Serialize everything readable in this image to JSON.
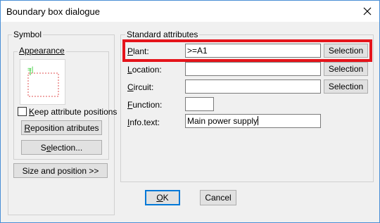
{
  "window": {
    "title": "Boundary box dialogue",
    "close_icon": "close-icon"
  },
  "symbol": {
    "group_label": "Symbol",
    "appearance_label": "Appearance",
    "keep_positions": {
      "label_first": "K",
      "label_rest": "eep attribute positions",
      "checked": false
    },
    "reposition_button": {
      "first": "R",
      "rest": "eposition atributes"
    },
    "selection_button": {
      "before": "S",
      "underlined": "e",
      "after": "lection..."
    },
    "size_position_button": "Size and position >>"
  },
  "standard": {
    "group_label": "Standard attributes",
    "fields": [
      {
        "first": "P",
        "rest": "lant:",
        "value": ">=A1",
        "has_selection": true
      },
      {
        "first": "L",
        "rest": "ocation:",
        "value": "",
        "has_selection": true
      },
      {
        "first": "C",
        "rest": "ircuit:",
        "value": "",
        "has_selection": true
      },
      {
        "first": "F",
        "rest": "unction:",
        "value": "",
        "has_selection": false
      },
      {
        "first": "I",
        "rest": "nfo.text:",
        "value": "Main power supply",
        "has_selection": false
      }
    ],
    "selection_label": "Selection"
  },
  "footer": {
    "ok": {
      "first": "O",
      "rest": "K"
    },
    "cancel": "Cancel"
  },
  "colors": {
    "highlight": "#e5141b",
    "focus": "#0078d7",
    "preview_mark": "#33cc33",
    "preview_box": "#e05050"
  }
}
